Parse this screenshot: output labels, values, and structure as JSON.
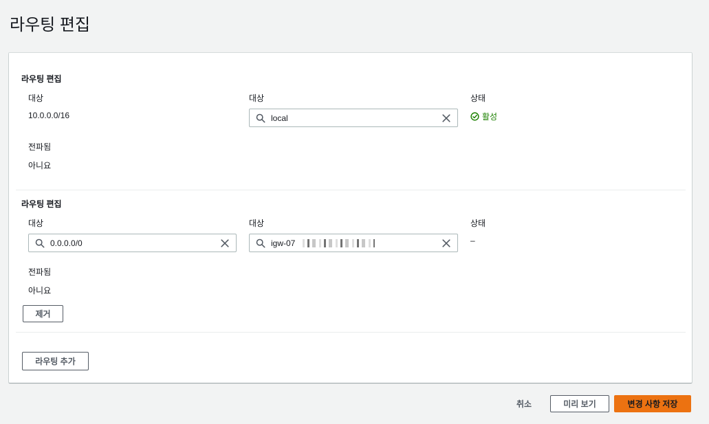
{
  "page": {
    "title": "라우팅 편집"
  },
  "routes": [
    {
      "section_title": "라우팅 편집",
      "destination_label": "대상",
      "destination_value": "10.0.0.0/16",
      "target_label": "대상",
      "target_value": "local",
      "status_label": "상태",
      "status_value": "활성",
      "propagated_label": "전파됨",
      "propagated_value": "아니요"
    },
    {
      "section_title": "라우팅 편집",
      "destination_label": "대상",
      "destination_value": "0.0.0.0/0",
      "target_label": "대상",
      "target_value": "igw-07",
      "status_label": "상태",
      "status_value": "–",
      "propagated_label": "전파됨",
      "propagated_value": "아니요",
      "remove_label": "제거"
    }
  ],
  "actions": {
    "add_route_label": "라우팅 추가",
    "cancel_label": "취소",
    "preview_label": "미리 보기",
    "save_label": "변경 사항 저장"
  },
  "colors": {
    "primary_button": "#ec7211",
    "status_active": "#1d8102"
  }
}
